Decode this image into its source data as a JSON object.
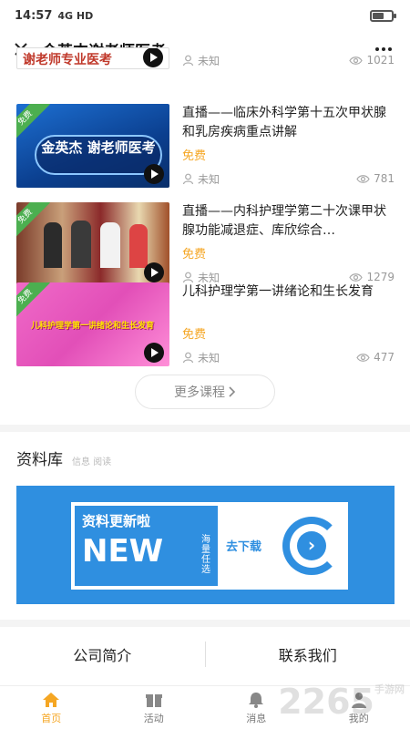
{
  "status": {
    "time": "14:57",
    "signal": "4G HD",
    "battery_level": 0.6
  },
  "header": {
    "title": "金英杰谢老师医考"
  },
  "courses": [
    {
      "thumb_text": "谢老师专业医考",
      "title": "",
      "price": "",
      "author": "未知",
      "views": "1021",
      "badge": ""
    },
    {
      "thumb_text": "金英杰 谢老师医考",
      "title": "直播——临床外科学第十五次甲状腺和乳房疾病重点讲解",
      "price": "免费",
      "author": "未知",
      "views": "781",
      "badge": "免费"
    },
    {
      "thumb_text": "",
      "title": "直播——内科护理学第二十次课甲状腺功能减退症、库欣综合…",
      "price": "免费",
      "author": "未知",
      "views": "1279",
      "badge": "免费"
    },
    {
      "thumb_text": "儿科护理学第一讲绪论和生长发育",
      "title": "儿科护理学第一讲绪论和生长发育",
      "price": "免费",
      "author": "未知",
      "views": "477",
      "badge": "免费"
    }
  ],
  "more_courses": "更多课程",
  "library": {
    "title": "资料库",
    "subtitle": "信息 阅读",
    "banner": {
      "line1": "资料更新啦",
      "line2": "NEW",
      "line3": "海量任选",
      "download": "去下载"
    }
  },
  "links": {
    "about": "公司简介",
    "contact": "联系我们"
  },
  "tabs": [
    {
      "label": "首页",
      "icon": "home-icon"
    },
    {
      "label": "活动",
      "icon": "gift-icon"
    },
    {
      "label": "消息",
      "icon": "bell-icon"
    },
    {
      "label": "我的",
      "icon": "person-icon"
    }
  ],
  "watermark": "2265",
  "watermark_sub": "手游网",
  "colors": {
    "accent": "#f5a623",
    "banner": "#2f8fe0",
    "badge": "#4caf50"
  }
}
